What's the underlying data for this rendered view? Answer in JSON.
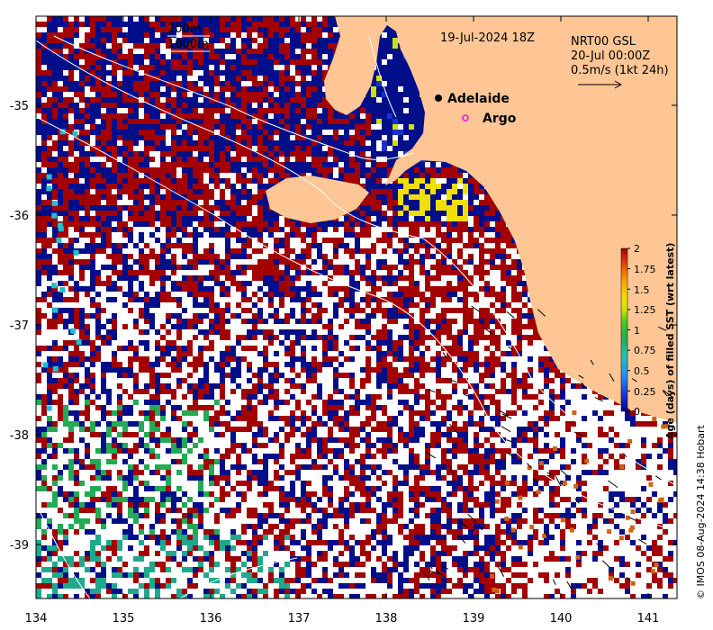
{
  "map": {
    "date_label": "19-Jul-2024 18Z",
    "legend_lines": [
      "NRT00 GSL",
      "20-Jul 00:00Z",
      "0.5m/s (1kt 24h)"
    ],
    "isobath_labels": [
      "200m",
      "1000m"
    ],
    "places": [
      {
        "name": "Adelaide",
        "marker": "filled-dot",
        "color": "#000000"
      },
      {
        "name": "Argo",
        "marker": "open-circle",
        "color": "#ff00ff"
      }
    ],
    "lon_ticks": [
      "134",
      "135",
      "136",
      "137",
      "138",
      "139",
      "140",
      "141"
    ],
    "lat_ticks": [
      "-35",
      "-36",
      "-37",
      "-38",
      "-39"
    ],
    "credit": "© IMOS 08-Aug-2024 14:38 Hobart",
    "colors": {
      "land": "#fdc694",
      "no_data": "#ffffff",
      "isobath": "#ffffff",
      "arrows": "#000000"
    }
  },
  "colorbar": {
    "title": "Age (days) of filled SST (wrt latest)",
    "ticks": [
      "2",
      "1.75",
      "1.5",
      "1.25",
      "1",
      "0.75",
      "0.5",
      "0.25",
      "0"
    ],
    "range": [
      0,
      2
    ],
    "colors": [
      "#00008b",
      "#1a33d9",
      "#1e90ff",
      "#20c0c0",
      "#20b050",
      "#44cc22",
      "#c8e400",
      "#f2e000",
      "#ffae00",
      "#ec7000",
      "#d43010",
      "#a30000"
    ]
  }
}
